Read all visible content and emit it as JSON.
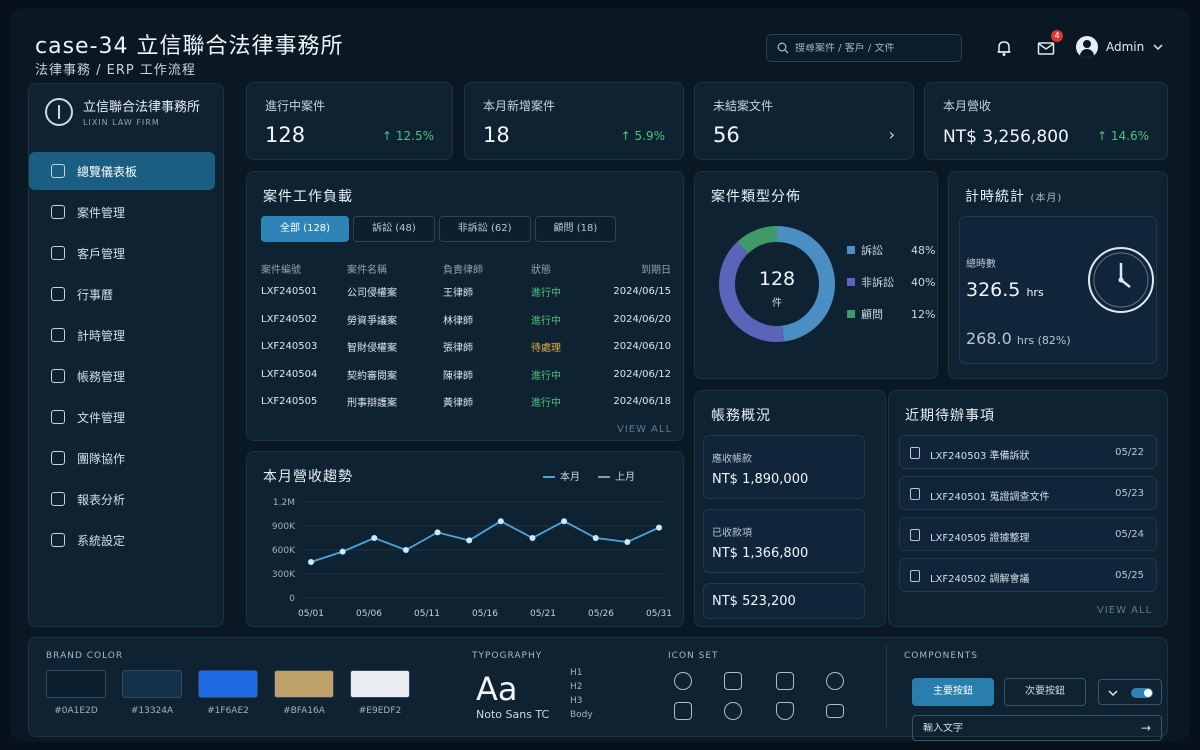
{
  "header": {
    "title": "case-34  立信聯合法律事務所",
    "subtitle": "法律事務 / ERP 工作流程",
    "search_placeholder": "搜尋案件 / 客戶 / 文件",
    "mail_badge": "4",
    "user_name": "Admin"
  },
  "sidebar": {
    "logo_name": "立信聯合法律事務所",
    "logo_en": "LIXIN LAW FIRM",
    "items": [
      {
        "label": "總覽儀表板",
        "icon": "dashboard-icon"
      },
      {
        "label": "案件管理",
        "icon": "case-icon"
      },
      {
        "label": "客戶管理",
        "icon": "client-icon"
      },
      {
        "label": "行事曆",
        "icon": "calendar-icon"
      },
      {
        "label": "計時管理",
        "icon": "clock-icon"
      },
      {
        "label": "帳務管理",
        "icon": "billing-icon"
      },
      {
        "label": "文件管理",
        "icon": "document-icon"
      },
      {
        "label": "團隊協作",
        "icon": "team-icon"
      },
      {
        "label": "報表分析",
        "icon": "report-icon"
      },
      {
        "label": "系統設定",
        "icon": "settings-icon"
      }
    ]
  },
  "kpis": [
    {
      "label": "進行中案件",
      "value": "128",
      "change": "↑ 12.5%"
    },
    {
      "label": "本月新增案件",
      "value": "18",
      "change": "↑ 5.9%"
    },
    {
      "label": "未結案文件",
      "value": "56",
      "change": "›"
    },
    {
      "label": "本月營收",
      "value": "NT$ 3,256,800",
      "change": "↑ 14.6%"
    }
  ],
  "workload": {
    "title": "案件工作負載",
    "tabs": [
      "全部 (128)",
      "訴訟 (48)",
      "非訴訟 (62)",
      "顧問 (18)"
    ],
    "columns": [
      "案件編號",
      "案件名稱",
      "負責律師",
      "狀態",
      "到期日"
    ],
    "rows": [
      [
        "LXF240501",
        "公司侵權案",
        "王律師",
        "進行中",
        "2024/06/15"
      ],
      [
        "LXF240502",
        "勞資爭議案",
        "林律師",
        "進行中",
        "2024/06/20"
      ],
      [
        "LXF240503",
        "智財侵權案",
        "張律師",
        "待處理",
        "2024/06/10"
      ],
      [
        "LXF240504",
        "契約審閱案",
        "陳律師",
        "進行中",
        "2024/06/12"
      ],
      [
        "LXF240505",
        "刑事辯護案",
        "黃律師",
        "進行中",
        "2024/06/18"
      ]
    ],
    "view_all": "VIEW ALL"
  },
  "case_types": {
    "title": "案件類型分佈",
    "center_value": "128",
    "center_unit": "件",
    "items": [
      {
        "label": "訴訟",
        "percent": "48%",
        "value": 48,
        "color": "#4a8ec4"
      },
      {
        "label": "非訴訟",
        "percent": "40%",
        "value": 40,
        "color": "#5a64b8"
      },
      {
        "label": "顧問",
        "percent": "12%",
        "value": 12,
        "color": "#3f9a6a"
      }
    ]
  },
  "timing": {
    "title": "計時統計",
    "period": "(本月)",
    "hours_label": "總時數",
    "hours_value": "326.5",
    "hours_unit": "hrs",
    "billable_value": "268.0",
    "billable_unit": "hrs (82%)"
  },
  "revenue": {
    "title": "本月營收趨勢",
    "legend_current": "本月",
    "legend_previous": "上月"
  },
  "chart_data": {
    "type": "line",
    "title": "本月營收趨勢",
    "x": [
      "05/01",
      "05/04",
      "05/06",
      "05/09",
      "05/11",
      "05/13",
      "05/16",
      "05/19",
      "05/21",
      "05/24",
      "05/26",
      "05/29",
      "05/31"
    ],
    "xticks": [
      "05/01",
      "05/06",
      "05/11",
      "05/16",
      "05/21",
      "05/26",
      "05/31"
    ],
    "yticks": [
      "0",
      "300K",
      "600K",
      "900K",
      "1.2M"
    ],
    "ylim": [
      0,
      1200000
    ],
    "series": [
      {
        "name": "本月",
        "values": [
          450000,
          580000,
          750000,
          600000,
          820000,
          720000,
          960000,
          750000,
          960000,
          750000,
          700000,
          880000
        ]
      }
    ]
  },
  "accounts": {
    "title": "帳務概況",
    "receivable_label": "應收帳款",
    "receivable_value": "NT$ 1,890,000",
    "received_label": "已收款項",
    "received_value": "NT$ 1,366,800",
    "balance_value": "NT$ 523,200"
  },
  "todos": {
    "title": "近期待辦事項",
    "items": [
      {
        "text": "LXF240503  準備訴狀",
        "date": "05/22"
      },
      {
        "text": "LXF240501  蒐證調查文件",
        "date": "05/23"
      },
      {
        "text": "LXF240505  證據整理",
        "date": "05/24"
      },
      {
        "text": "LXF240502  調解會議",
        "date": "05/25"
      }
    ],
    "view_all": "VIEW ALL"
  },
  "styleguide": {
    "brand_label": "BRAND COLOR",
    "colors": [
      "#0A1E2D",
      "#13324A",
      "#1F6AE2",
      "#BFA16A",
      "#E9EDF2"
    ],
    "typo_label": "TYPOGRAPHY",
    "typo_sample": "Aa",
    "typo_font": "Noto Sans TC",
    "typo_levels": [
      "H1",
      "H2",
      "H3",
      "Body"
    ],
    "icon_label": "ICON SET",
    "comp_label": "COMPONENTS",
    "primary_btn": "主要按鈕",
    "secondary_btn": "次要按鈕",
    "input_placeholder": "輸入文字"
  }
}
